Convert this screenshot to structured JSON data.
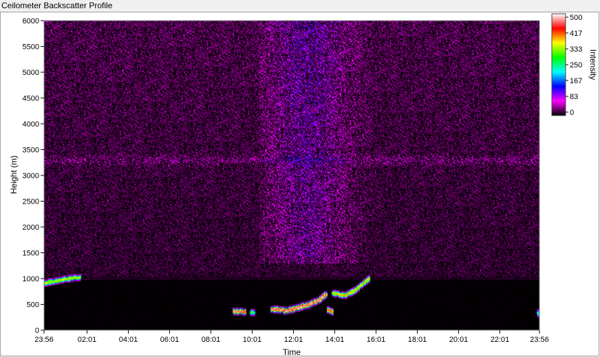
{
  "window": {
    "title": "Ceilometer Backscatter Profile"
  },
  "chart_data": {
    "type": "heatmap",
    "xlabel": "Time",
    "ylabel": "Height (m)",
    "x_ticks": [
      "23:56",
      "02:01",
      "04:01",
      "06:01",
      "08:01",
      "10:01",
      "12:01",
      "14:01",
      "16:01",
      "18:01",
      "20:01",
      "22:01",
      "23:56"
    ],
    "y_ticks": [
      0,
      500,
      1000,
      1500,
      2000,
      2500,
      3000,
      3500,
      4000,
      4500,
      5000,
      5500,
      6000
    ],
    "ylim": [
      0,
      6000
    ],
    "colorbar": {
      "label": "Intensity",
      "ticks": [
        0,
        83,
        167,
        250,
        333,
        417,
        500
      ],
      "range": [
        0,
        500
      ],
      "stops": [
        "#000000",
        "#ff00ff",
        "#0000ff",
        "#00ffff",
        "#00ff00",
        "#ffff00",
        "#ff0000",
        "#ffffff"
      ]
    },
    "cloud_layers": [
      {
        "points": [
          [
            "23:56",
            920
          ],
          [
            "00:30",
            960
          ],
          [
            "01:10",
            1010
          ],
          [
            "01:40",
            1020
          ]
        ],
        "intensity": 300
      },
      {
        "points": [
          [
            "09:05",
            370
          ],
          [
            "09:40",
            360
          ]
        ],
        "intensity": 420
      },
      {
        "points": [
          [
            "09:55",
            350
          ],
          [
            "10:05",
            350
          ]
        ],
        "intensity": 250
      },
      {
        "points": [
          [
            "10:55",
            420
          ],
          [
            "11:40",
            380
          ],
          [
            "12:10",
            440
          ],
          [
            "12:45",
            500
          ],
          [
            "13:20",
            610
          ],
          [
            "13:35",
            700
          ]
        ],
        "intensity": 420
      },
      {
        "points": [
          [
            "13:40",
            400
          ],
          [
            "13:55",
            360
          ]
        ],
        "intensity": 380
      },
      {
        "points": [
          [
            "13:55",
            720
          ],
          [
            "14:30",
            680
          ],
          [
            "15:00",
            780
          ],
          [
            "15:30",
            950
          ],
          [
            "15:40",
            1000
          ]
        ],
        "intensity": 320
      },
      {
        "points": [
          [
            "23:50",
            360
          ],
          [
            "23:52",
            320
          ]
        ],
        "intensity": 220
      }
    ],
    "aerosol_plume": {
      "start": "10:20",
      "end": "15:50",
      "peak": "12:40",
      "base_height": 1300,
      "top_height": 6000
    },
    "enhanced_band_height": 3300
  }
}
